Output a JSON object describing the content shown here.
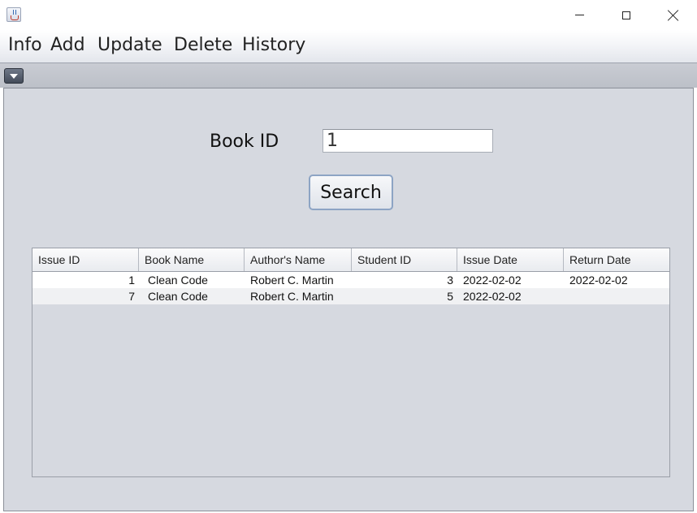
{
  "menu": {
    "items": [
      "Info",
      "Add",
      "Update",
      "Delete",
      "History"
    ]
  },
  "form": {
    "book_id_label": "Book ID",
    "book_id_value": "1",
    "search_label": "Search"
  },
  "table": {
    "columns": [
      "Issue ID",
      "Book Name",
      "Author's Name",
      "Student ID",
      "Issue Date",
      "Return Date"
    ],
    "rows": [
      [
        "1",
        "Clean Code",
        "Robert C. Martin",
        "3",
        "2022-02-02",
        "2022-02-02"
      ],
      [
        "7",
        "Clean Code",
        "Robert C. Martin",
        "5",
        "2022-02-02",
        ""
      ]
    ]
  },
  "icons": {
    "app": "java-cup-icon",
    "minimize": "minimize-icon",
    "maximize": "maximize-icon",
    "close": "close-icon",
    "toggle": "dropdown-triangle-icon"
  }
}
